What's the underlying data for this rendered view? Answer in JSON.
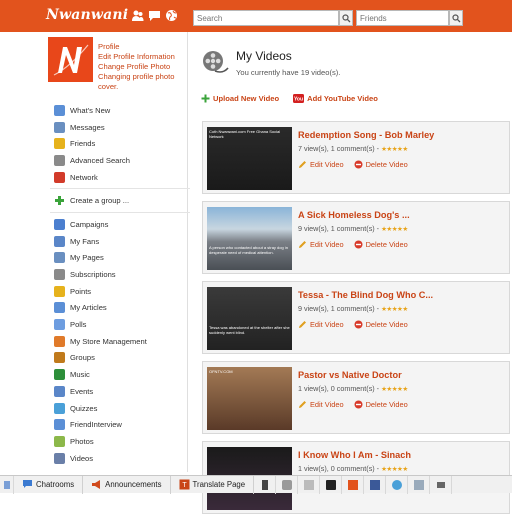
{
  "header": {
    "logo_text": "Nwanwani",
    "search_placeholder": "Search",
    "friends_placeholder": "Friends"
  },
  "profile": {
    "links": [
      "Profile",
      "Edit Profile Information",
      "Change Profile Photo",
      "Changing profile photo",
      "cover."
    ]
  },
  "sidebar": {
    "group1": [
      "What's New",
      "Messages",
      "Friends",
      "Advanced Search",
      "Network"
    ],
    "group2": [
      "Create a group ..."
    ],
    "group3": [
      "Campaigns",
      "My Fans",
      "My Pages",
      "Subscriptions",
      "Points",
      "My Articles",
      "Polls",
      "My Store Management",
      "Groups",
      "Music",
      "Events",
      "Quizzes",
      "FriendInterview",
      "Photos",
      "Videos"
    ],
    "colors": {
      "group1": [
        "#5b8fd6",
        "#6a8fc0",
        "#e6b21c",
        "#8a8a8a",
        "#d23b2a"
      ],
      "group3": [
        "#4b7fcf",
        "#5a86c8",
        "#6a8fc0",
        "#8a8a8a",
        "#e6b21c",
        "#5b8fd6",
        "#6d9de0",
        "#e07a2a",
        "#c07a1c",
        "#2d8f3a",
        "#5a86c8",
        "#4aa0d8",
        "#5b8fd6",
        "#8cb84a",
        "#6a7fa8"
      ]
    }
  },
  "main": {
    "title": "My Videos",
    "subtitle": "You currently have 19 video(s).",
    "upload_label": "Upload New Video",
    "youtube_label": "Add YouTube Video",
    "edit_label": "Edit Video",
    "delete_label": "Delete Video",
    "videos": [
      {
        "title": "Redemption Song - Bob Marley",
        "meta": "7 view(s), 1 comment(s) -",
        "thumb_text": "Coth Nwanwani.com Free Ghana Social Network"
      },
      {
        "title": "A Sick Homeless Dog's ...",
        "meta": "9 view(s), 1 comment(s) -",
        "thumb_text": "A person who contacted about a stray dog in desperate need of medical attention."
      },
      {
        "title": "Tessa - The Blind Dog Who C...",
        "meta": "9 view(s), 1 comment(s) -",
        "thumb_text": "Tessa was abandoned at the shelter after she suddenly went blind."
      },
      {
        "title": "Pastor vs Native Doctor",
        "meta": "1 view(s), 0 comment(s) -",
        "thumb_text": "OFNTV.COM"
      },
      {
        "title": "I Know Who I Am - Sinach",
        "meta": "1 view(s), 0 comment(s) -",
        "thumb_text": ""
      }
    ]
  },
  "bottombar": {
    "chatrooms": "Chatrooms",
    "announcements": "Announcements",
    "translate": "Translate Page"
  },
  "colors": {
    "brand": "#e2531d",
    "link": "#c94416",
    "star": "#e8a317"
  }
}
